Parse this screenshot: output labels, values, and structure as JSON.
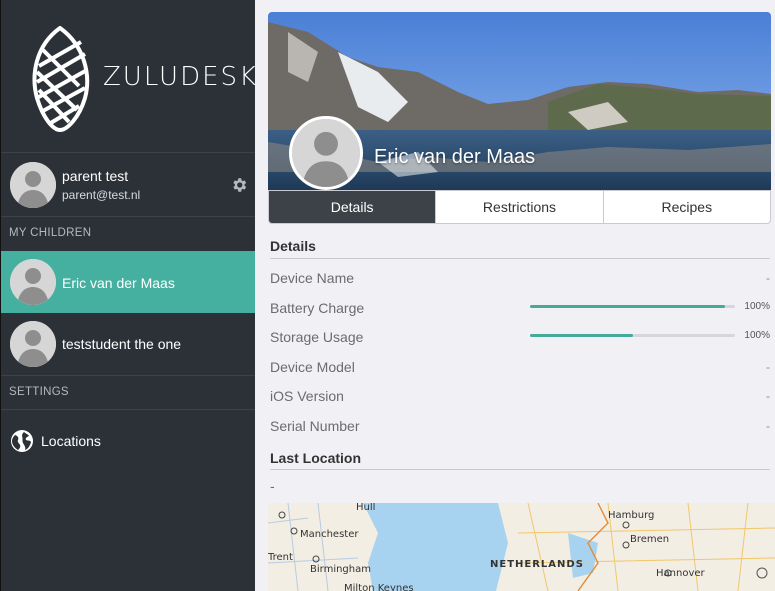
{
  "brand": "ZULUDESK",
  "parent": {
    "name": "parent test",
    "email": "parent@test.nl"
  },
  "sidebar": {
    "my_children_header": "MY CHILDREN",
    "children": [
      {
        "name": "Eric  van der Maas"
      },
      {
        "name": "teststudent the one"
      }
    ],
    "settings_header": "SETTINGS",
    "locations_label": "Locations"
  },
  "profile": {
    "name": "Eric  van der Maas"
  },
  "tabs": [
    "Details",
    "Restrictions",
    "Recipes"
  ],
  "details": {
    "title": "Details",
    "fields": [
      {
        "label": "Device Name",
        "value": "-"
      },
      {
        "label": "Battery Charge",
        "value": "100%",
        "progress": 0.95
      },
      {
        "label": "Storage Usage",
        "value": "100%",
        "progress": 0.5
      },
      {
        "label": "Device Model",
        "value": "-"
      },
      {
        "label": "iOS Version",
        "value": "-"
      },
      {
        "label": "Serial Number",
        "value": "-"
      }
    ]
  },
  "last_location": {
    "title": "Last Location",
    "value": "-"
  },
  "map_labels": {
    "hull": "Hull",
    "manchester": "Manchester",
    "trent": "Trent",
    "birmingham": "Birmingham",
    "milton": "Milton Keynes",
    "netherlands": "NETHERLANDS",
    "hamburg": "Hamburg",
    "bremen": "Bremen",
    "hannover": "Hannover"
  },
  "colors": {
    "sidebar_bg": "#2c3137",
    "accent": "#46b0a0",
    "tab_active": "#3c4248"
  }
}
